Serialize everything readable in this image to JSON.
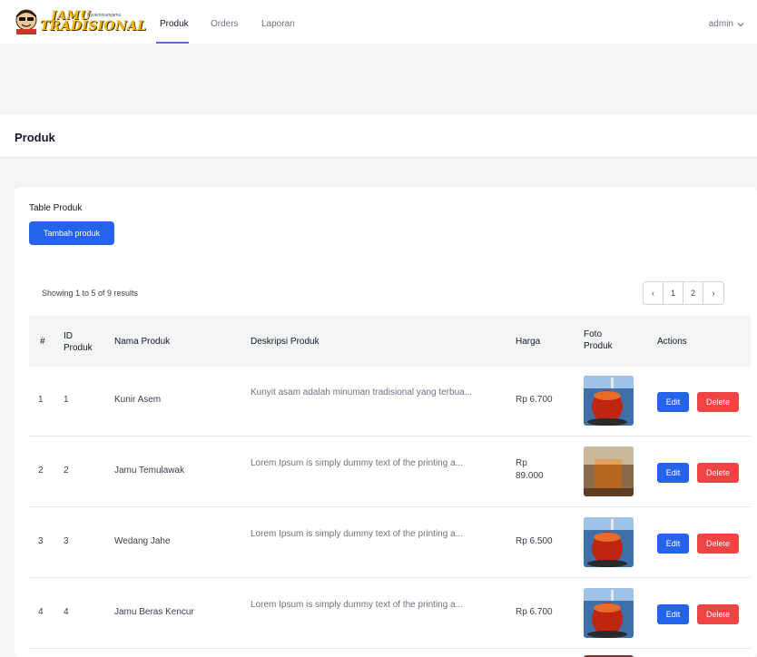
{
  "logo": {
    "line1": "JAMU",
    "tagline": "Nyukminumjamu",
    "line2": "TRADISIONAL"
  },
  "nav": {
    "items": [
      {
        "label": "Produk"
      },
      {
        "label": "Orders"
      },
      {
        "label": "Laporan"
      }
    ]
  },
  "user": {
    "name": "admin",
    "icon": "chevron-down-icon"
  },
  "header": {
    "title": "Produk"
  },
  "card": {
    "title": "Table Produk",
    "add_button": "Tambah produk",
    "showing": "Showing 1 to 5 of 9 results"
  },
  "pagination": {
    "prev": "‹",
    "pages": [
      "1",
      "2"
    ],
    "next": "›"
  },
  "table": {
    "headers": [
      "#",
      "ID\nProduk",
      "Nama Produk",
      "Deskripsi Produk",
      "Harga",
      "Foto\nProduk",
      "Actions"
    ],
    "rows": [
      {
        "no": "1",
        "id": "1",
        "name": "Kunir Asem",
        "desc": "Kunyit asam adalah minuman tradisional yang terbua...",
        "price": "Rp 6.700",
        "photo": "glass-red-drink",
        "edit": "Edit",
        "delete": "Delete"
      },
      {
        "no": "2",
        "id": "2",
        "name": "Jamu Temulawak",
        "desc": "Lorem Ipsum is simply dummy text of the printing a...",
        "price": "Rp 89.000",
        "photo": "glass-brown-drink",
        "edit": "Edit",
        "delete": "Delete"
      },
      {
        "no": "3",
        "id": "3",
        "name": "Wedang Jahe",
        "desc": "Lorem Ipsum is simply dummy text of the printing a...",
        "price": "Rp 6.500",
        "photo": "glass-red-drink",
        "edit": "Edit",
        "delete": "Delete"
      },
      {
        "no": "4",
        "id": "4",
        "name": "Jamu Beras Kencur",
        "desc": "Lorem Ipsum is simply dummy text of the printing a...",
        "price": "Rp 6.700",
        "photo": "glass-red-drink",
        "edit": "Edit",
        "delete": "Delete"
      }
    ]
  },
  "colors": {
    "primary": "#2563eb",
    "danger": "#ef4444",
    "accent": "#6366f1",
    "logo": "#f4b400"
  }
}
